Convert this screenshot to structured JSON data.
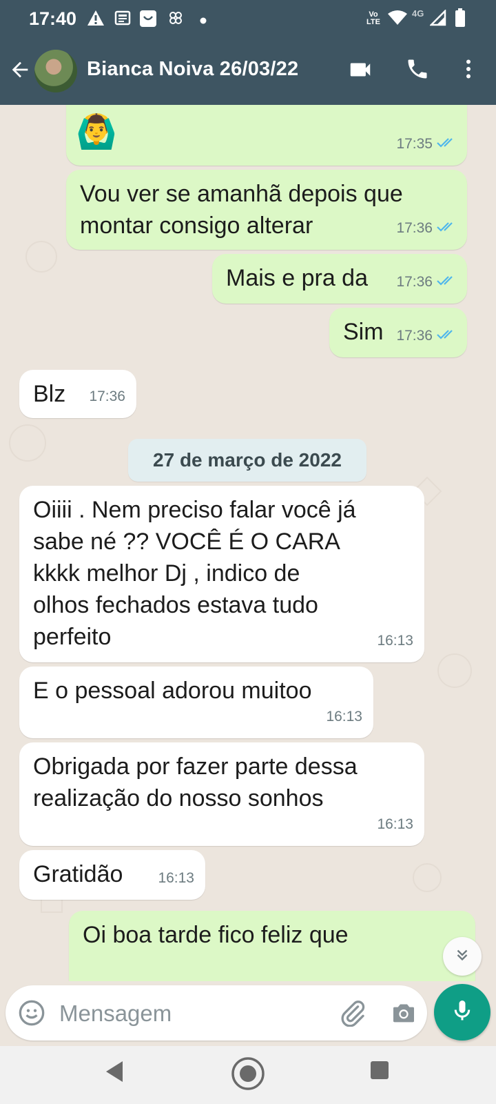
{
  "status_bar": {
    "time": "17:40",
    "network_label": "4G",
    "volte_label": "Vo LTE"
  },
  "header": {
    "title": "Bianca Noiva 26/03/22"
  },
  "messages": [
    {
      "direction": "out",
      "text": "",
      "emoji": "🙆‍♂️",
      "time": "17:35",
      "read": true
    },
    {
      "direction": "out",
      "text": "Vou ver se amanhã depois que\nmontar consigo alterar",
      "time": "17:36",
      "read": true
    },
    {
      "direction": "out",
      "text": "Mais e pra da",
      "time": "17:36",
      "read": true
    },
    {
      "direction": "out",
      "text": "Sim",
      "time": "17:36",
      "read": true
    },
    {
      "direction": "in",
      "text": "Blz",
      "time": "17:36"
    },
    {
      "direction": "in",
      "text": "Oiiii . Nem preciso falar você já\nsabe né ?? VOCÊ É O CARA\nkkkk melhor Dj , indico de\nolhos fechados estava tudo\nperfeito",
      "time": "16:13"
    },
    {
      "direction": "in",
      "text": "E o pessoal adorou muitoo",
      "time": "16:13"
    },
    {
      "direction": "in",
      "text": "Obrigada por fazer parte dessa\nrealização do nosso sonhos",
      "time": "16:13"
    },
    {
      "direction": "in",
      "text": "Gratidão",
      "time": "16:13"
    },
    {
      "direction": "out",
      "text": "Oi boa tarde fico feliz que",
      "time": ""
    }
  ],
  "date_divider": "27 de março de 2022",
  "composer": {
    "placeholder": "Mensagem"
  },
  "colors": {
    "header": "#3e5562",
    "outgoing_bubble": "#dcf8c6",
    "incoming_bubble": "#ffffff",
    "chat_background": "#ece5dd",
    "mic_button": "#0f9e86",
    "read_tick": "#4fb6ec"
  },
  "icons": [
    "back-arrow-icon",
    "video-call-icon",
    "phone-icon",
    "more-vert-icon",
    "emoji-icon",
    "attach-icon",
    "camera-icon",
    "mic-icon",
    "scroll-down-icon",
    "nav-back-icon",
    "nav-home-icon",
    "nav-recents-icon"
  ]
}
